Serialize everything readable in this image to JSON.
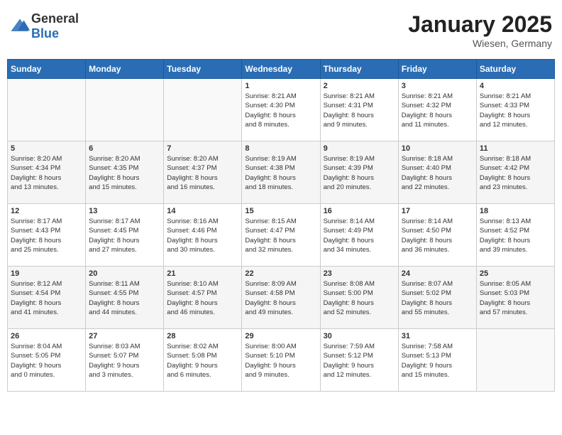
{
  "header": {
    "logo_general": "General",
    "logo_blue": "Blue",
    "title": "January 2025",
    "location": "Wiesen, Germany"
  },
  "days_of_week": [
    "Sunday",
    "Monday",
    "Tuesday",
    "Wednesday",
    "Thursday",
    "Friday",
    "Saturday"
  ],
  "weeks": [
    [
      {
        "day": "",
        "info": ""
      },
      {
        "day": "",
        "info": ""
      },
      {
        "day": "",
        "info": ""
      },
      {
        "day": "1",
        "info": "Sunrise: 8:21 AM\nSunset: 4:30 PM\nDaylight: 8 hours\nand 8 minutes."
      },
      {
        "day": "2",
        "info": "Sunrise: 8:21 AM\nSunset: 4:31 PM\nDaylight: 8 hours\nand 9 minutes."
      },
      {
        "day": "3",
        "info": "Sunrise: 8:21 AM\nSunset: 4:32 PM\nDaylight: 8 hours\nand 11 minutes."
      },
      {
        "day": "4",
        "info": "Sunrise: 8:21 AM\nSunset: 4:33 PM\nDaylight: 8 hours\nand 12 minutes."
      }
    ],
    [
      {
        "day": "5",
        "info": "Sunrise: 8:20 AM\nSunset: 4:34 PM\nDaylight: 8 hours\nand 13 minutes."
      },
      {
        "day": "6",
        "info": "Sunrise: 8:20 AM\nSunset: 4:35 PM\nDaylight: 8 hours\nand 15 minutes."
      },
      {
        "day": "7",
        "info": "Sunrise: 8:20 AM\nSunset: 4:37 PM\nDaylight: 8 hours\nand 16 minutes."
      },
      {
        "day": "8",
        "info": "Sunrise: 8:19 AM\nSunset: 4:38 PM\nDaylight: 8 hours\nand 18 minutes."
      },
      {
        "day": "9",
        "info": "Sunrise: 8:19 AM\nSunset: 4:39 PM\nDaylight: 8 hours\nand 20 minutes."
      },
      {
        "day": "10",
        "info": "Sunrise: 8:18 AM\nSunset: 4:40 PM\nDaylight: 8 hours\nand 22 minutes."
      },
      {
        "day": "11",
        "info": "Sunrise: 8:18 AM\nSunset: 4:42 PM\nDaylight: 8 hours\nand 23 minutes."
      }
    ],
    [
      {
        "day": "12",
        "info": "Sunrise: 8:17 AM\nSunset: 4:43 PM\nDaylight: 8 hours\nand 25 minutes."
      },
      {
        "day": "13",
        "info": "Sunrise: 8:17 AM\nSunset: 4:45 PM\nDaylight: 8 hours\nand 27 minutes."
      },
      {
        "day": "14",
        "info": "Sunrise: 8:16 AM\nSunset: 4:46 PM\nDaylight: 8 hours\nand 30 minutes."
      },
      {
        "day": "15",
        "info": "Sunrise: 8:15 AM\nSunset: 4:47 PM\nDaylight: 8 hours\nand 32 minutes."
      },
      {
        "day": "16",
        "info": "Sunrise: 8:14 AM\nSunset: 4:49 PM\nDaylight: 8 hours\nand 34 minutes."
      },
      {
        "day": "17",
        "info": "Sunrise: 8:14 AM\nSunset: 4:50 PM\nDaylight: 8 hours\nand 36 minutes."
      },
      {
        "day": "18",
        "info": "Sunrise: 8:13 AM\nSunset: 4:52 PM\nDaylight: 8 hours\nand 39 minutes."
      }
    ],
    [
      {
        "day": "19",
        "info": "Sunrise: 8:12 AM\nSunset: 4:54 PM\nDaylight: 8 hours\nand 41 minutes."
      },
      {
        "day": "20",
        "info": "Sunrise: 8:11 AM\nSunset: 4:55 PM\nDaylight: 8 hours\nand 44 minutes."
      },
      {
        "day": "21",
        "info": "Sunrise: 8:10 AM\nSunset: 4:57 PM\nDaylight: 8 hours\nand 46 minutes."
      },
      {
        "day": "22",
        "info": "Sunrise: 8:09 AM\nSunset: 4:58 PM\nDaylight: 8 hours\nand 49 minutes."
      },
      {
        "day": "23",
        "info": "Sunrise: 8:08 AM\nSunset: 5:00 PM\nDaylight: 8 hours\nand 52 minutes."
      },
      {
        "day": "24",
        "info": "Sunrise: 8:07 AM\nSunset: 5:02 PM\nDaylight: 8 hours\nand 55 minutes."
      },
      {
        "day": "25",
        "info": "Sunrise: 8:05 AM\nSunset: 5:03 PM\nDaylight: 8 hours\nand 57 minutes."
      }
    ],
    [
      {
        "day": "26",
        "info": "Sunrise: 8:04 AM\nSunset: 5:05 PM\nDaylight: 9 hours\nand 0 minutes."
      },
      {
        "day": "27",
        "info": "Sunrise: 8:03 AM\nSunset: 5:07 PM\nDaylight: 9 hours\nand 3 minutes."
      },
      {
        "day": "28",
        "info": "Sunrise: 8:02 AM\nSunset: 5:08 PM\nDaylight: 9 hours\nand 6 minutes."
      },
      {
        "day": "29",
        "info": "Sunrise: 8:00 AM\nSunset: 5:10 PM\nDaylight: 9 hours\nand 9 minutes."
      },
      {
        "day": "30",
        "info": "Sunrise: 7:59 AM\nSunset: 5:12 PM\nDaylight: 9 hours\nand 12 minutes."
      },
      {
        "day": "31",
        "info": "Sunrise: 7:58 AM\nSunset: 5:13 PM\nDaylight: 9 hours\nand 15 minutes."
      },
      {
        "day": "",
        "info": ""
      }
    ]
  ]
}
